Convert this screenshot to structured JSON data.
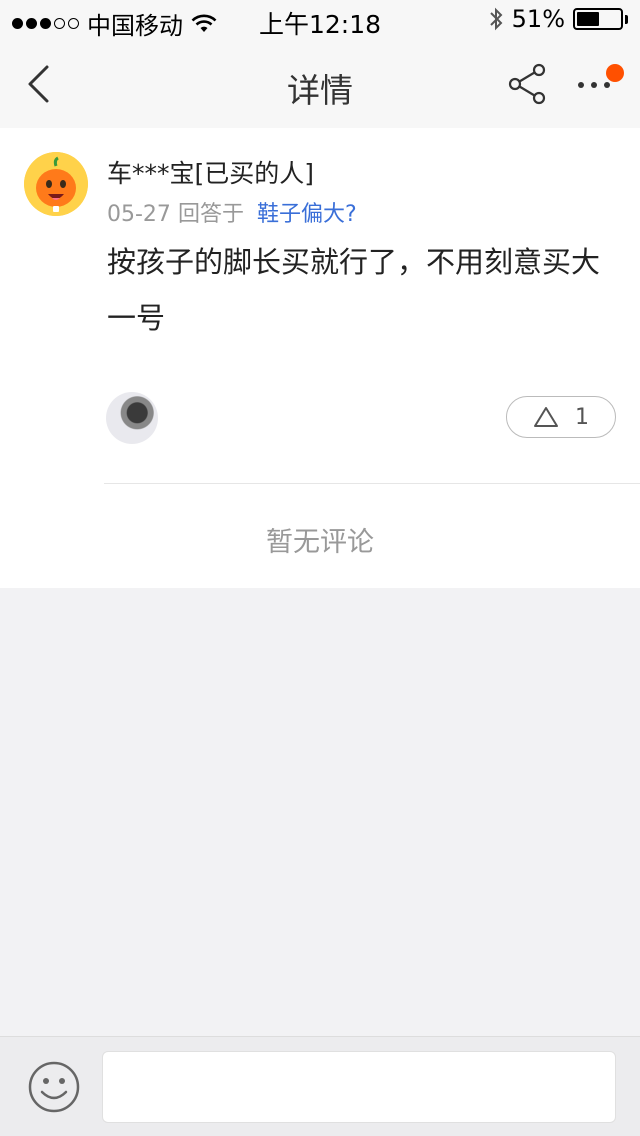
{
  "status_bar": {
    "carrier": "中国移动",
    "time": "上午12:18",
    "battery_percent": "51%",
    "battery_level": 0.51
  },
  "nav": {
    "title": "详情"
  },
  "post": {
    "user_name": "车***宝[已买的人]",
    "date": "05-27",
    "reply_prefix": "回答于",
    "question": "鞋子偏大?",
    "answer": "按孩子的脚长买就行了，不用刻意买大一号",
    "like_count": "1"
  },
  "comments": {
    "empty_text": "暂无评论"
  },
  "input": {
    "placeholder": ""
  },
  "colors": {
    "accent_orange": "#ff5000",
    "link_blue": "#3a6fd8"
  }
}
